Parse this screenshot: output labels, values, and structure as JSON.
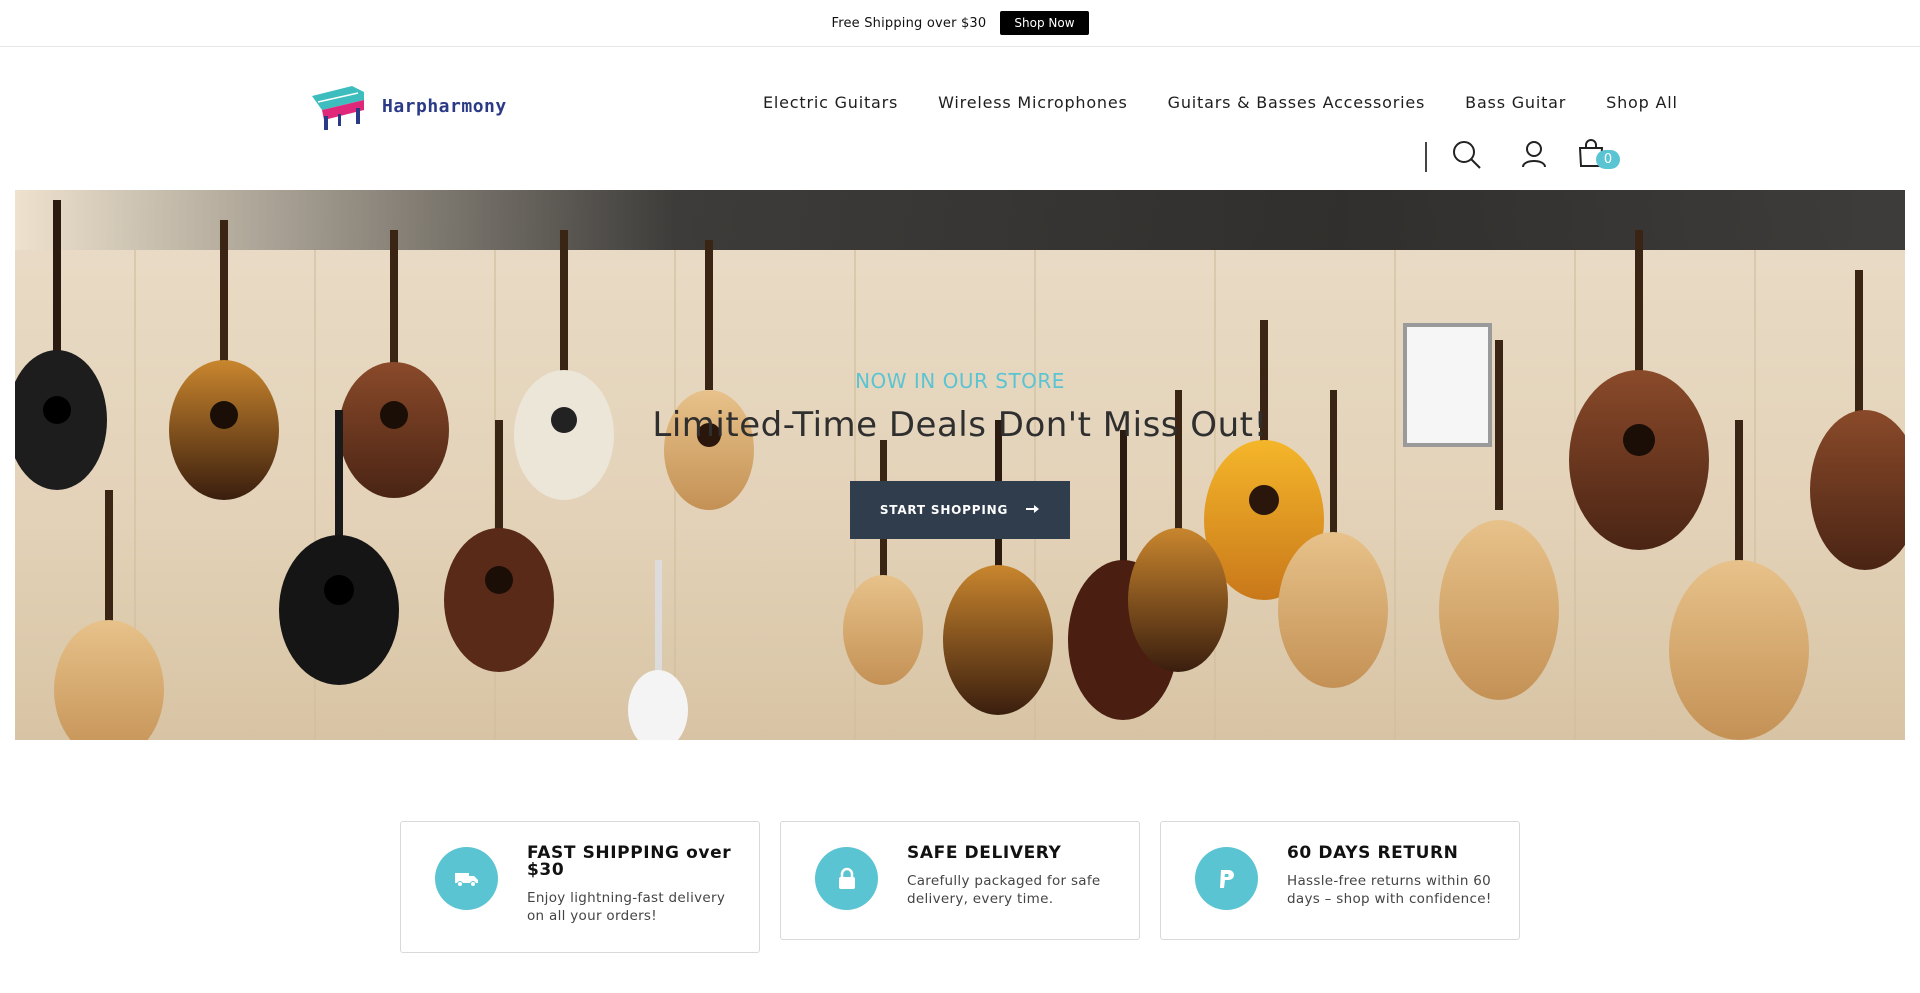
{
  "announcement": {
    "text": "Free Shipping over $30",
    "button": "Shop Now"
  },
  "brand": {
    "name": "Harpharmony",
    "logo_icon": "piano-logo-icon"
  },
  "nav": {
    "items": [
      {
        "label": "Electric Guitars"
      },
      {
        "label": "Wireless Microphones"
      },
      {
        "label": "Guitars & Basses Accessories"
      },
      {
        "label": "Bass Guitar"
      },
      {
        "label": "Shop All"
      }
    ]
  },
  "header_tools": {
    "search_icon": "search-icon",
    "account_icon": "user-icon",
    "cart_icon": "shopping-bag-icon",
    "cart_count": "0"
  },
  "hero": {
    "subtitle": "NOW IN OUR STORE",
    "title": "Limited-Time Deals Don't Miss Out!",
    "button": "START SHOPPING",
    "button_icon": "arrow-right-icon"
  },
  "features": [
    {
      "icon": "truck-icon",
      "title": "FAST SHIPPING over $30",
      "description": "Enjoy lightning-fast delivery on all your orders!"
    },
    {
      "icon": "lock-icon",
      "title": "SAFE DELIVERY",
      "description": "Carefully packaged for safe delivery, every time."
    },
    {
      "icon": "paypal-icon",
      "title": "60 DAYS RETURN",
      "description": "Hassle-free returns within 60 days – shop with confidence!"
    }
  ],
  "colors": {
    "accent": "#5bc4d2",
    "button_dark": "#2f3d4d",
    "brand_text": "#2b3a86"
  }
}
